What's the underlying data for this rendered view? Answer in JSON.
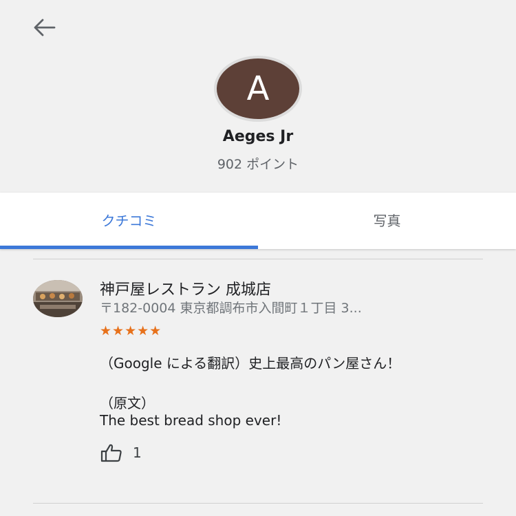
{
  "header": {
    "back_icon": "arrow-left-icon"
  },
  "profile": {
    "avatar_letter": "A",
    "avatar_color": "#5d4037",
    "name": "Aeges Jr",
    "points": "902 ポイント"
  },
  "tabs": [
    {
      "label": "クチコミ",
      "active": true
    },
    {
      "label": "写真",
      "active": false
    }
  ],
  "accent_color": "#3c78d8",
  "review": {
    "place_name": "神戸屋レストラン 成城店",
    "address": "〒182-0004 東京都調布市入間町１丁目 3...",
    "rating": 5,
    "stars": "★★★★★",
    "star_color": "#e7711b",
    "translated_text": "（Google による翻訳）史上最高のパン屋さん！",
    "original_label": "（原文）",
    "original_text": "The best bread shop ever!",
    "like_icon": "thumbs-up-icon",
    "like_count": "1"
  }
}
